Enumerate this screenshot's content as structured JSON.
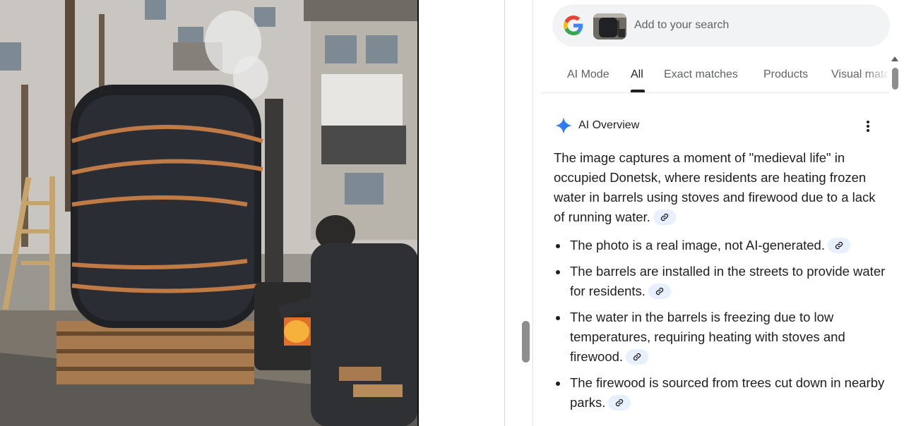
{
  "search": {
    "placeholder": "Add to your search",
    "logo_icon": "google-g-icon",
    "thumbnail_icon": "image-thumbnail"
  },
  "tabs": [
    {
      "label": "AI Mode",
      "active": false
    },
    {
      "label": "All",
      "active": true
    },
    {
      "label": "Exact matches",
      "active": false
    },
    {
      "label": "Products",
      "active": false
    },
    {
      "label": "Visual matches",
      "active": false
    }
  ],
  "ai_overview": {
    "title": "AI Overview",
    "icon": "sparkle-icon",
    "menu_icon": "more-vert-icon",
    "intro": "The image captures a moment of \"medieval life\" in occupied Donetsk, where residents are heating frozen water in barrels using stoves and firewood due to a lack of running water.",
    "bullets": [
      "The photo is a real image, not AI-generated.",
      "The barrels are installed in the streets to provide water for residents.",
      "The water in the barrels is freezing due to low temperatures, requiring heating with stoves and firewood.",
      "The firewood is sourced from trees cut down in nearby parks."
    ],
    "link_icon": "link-icon"
  },
  "colors": {
    "accent_chip": "#e8f0fe",
    "sparkle_blue": "#4285f4",
    "text": "#1f1f1f",
    "muted": "#5f6368"
  }
}
